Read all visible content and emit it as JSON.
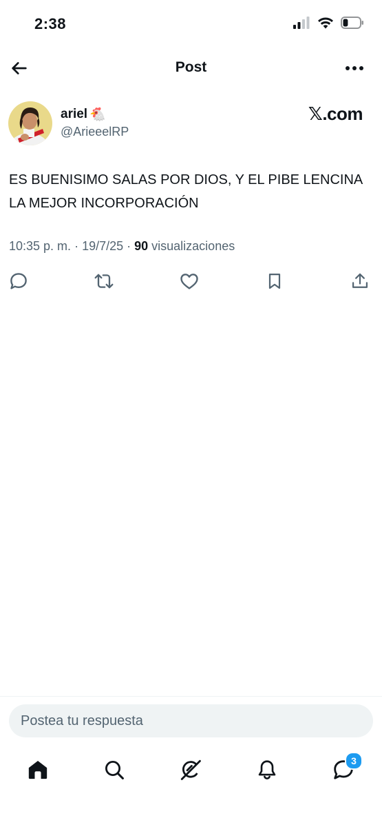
{
  "status_bar": {
    "time": "2:38",
    "icons": [
      "cellular-signal-icon",
      "wifi-icon",
      "battery-icon"
    ],
    "battery_level": 0.3
  },
  "header": {
    "title": "Post",
    "back_icon": "arrow-left-icon",
    "more_icon": "more-horizontal-icon"
  },
  "post": {
    "author": {
      "name": "ariel",
      "emoji": "🐔",
      "handle": "@ArieeelRP"
    },
    "brand": {
      "logo_glyph": "𝕏",
      "suffix": ".com"
    },
    "text": "ES BUENISIMO SALAS POR DIOS, Y EL PIBE LENCINA LA MEJOR INCORPORACIÓN",
    "meta": {
      "time": "10:35 p. m.",
      "separator": " · ",
      "date": "19/7/25",
      "views_count": "90",
      "views_label": " visualizaciones"
    },
    "actions": [
      "reply-icon",
      "repost-icon",
      "like-icon",
      "bookmark-icon",
      "share-icon"
    ]
  },
  "reply": {
    "placeholder": "Postea tu respuesta"
  },
  "tab_bar": {
    "items": [
      "home-icon",
      "search-icon",
      "grok-icon",
      "notifications-icon",
      "messages-icon"
    ],
    "messages_badge": "3"
  },
  "colors": {
    "text": "#0f1419",
    "secondary": "#536471",
    "input_bg": "#eff3f4",
    "accent": "#1d9bf0"
  }
}
